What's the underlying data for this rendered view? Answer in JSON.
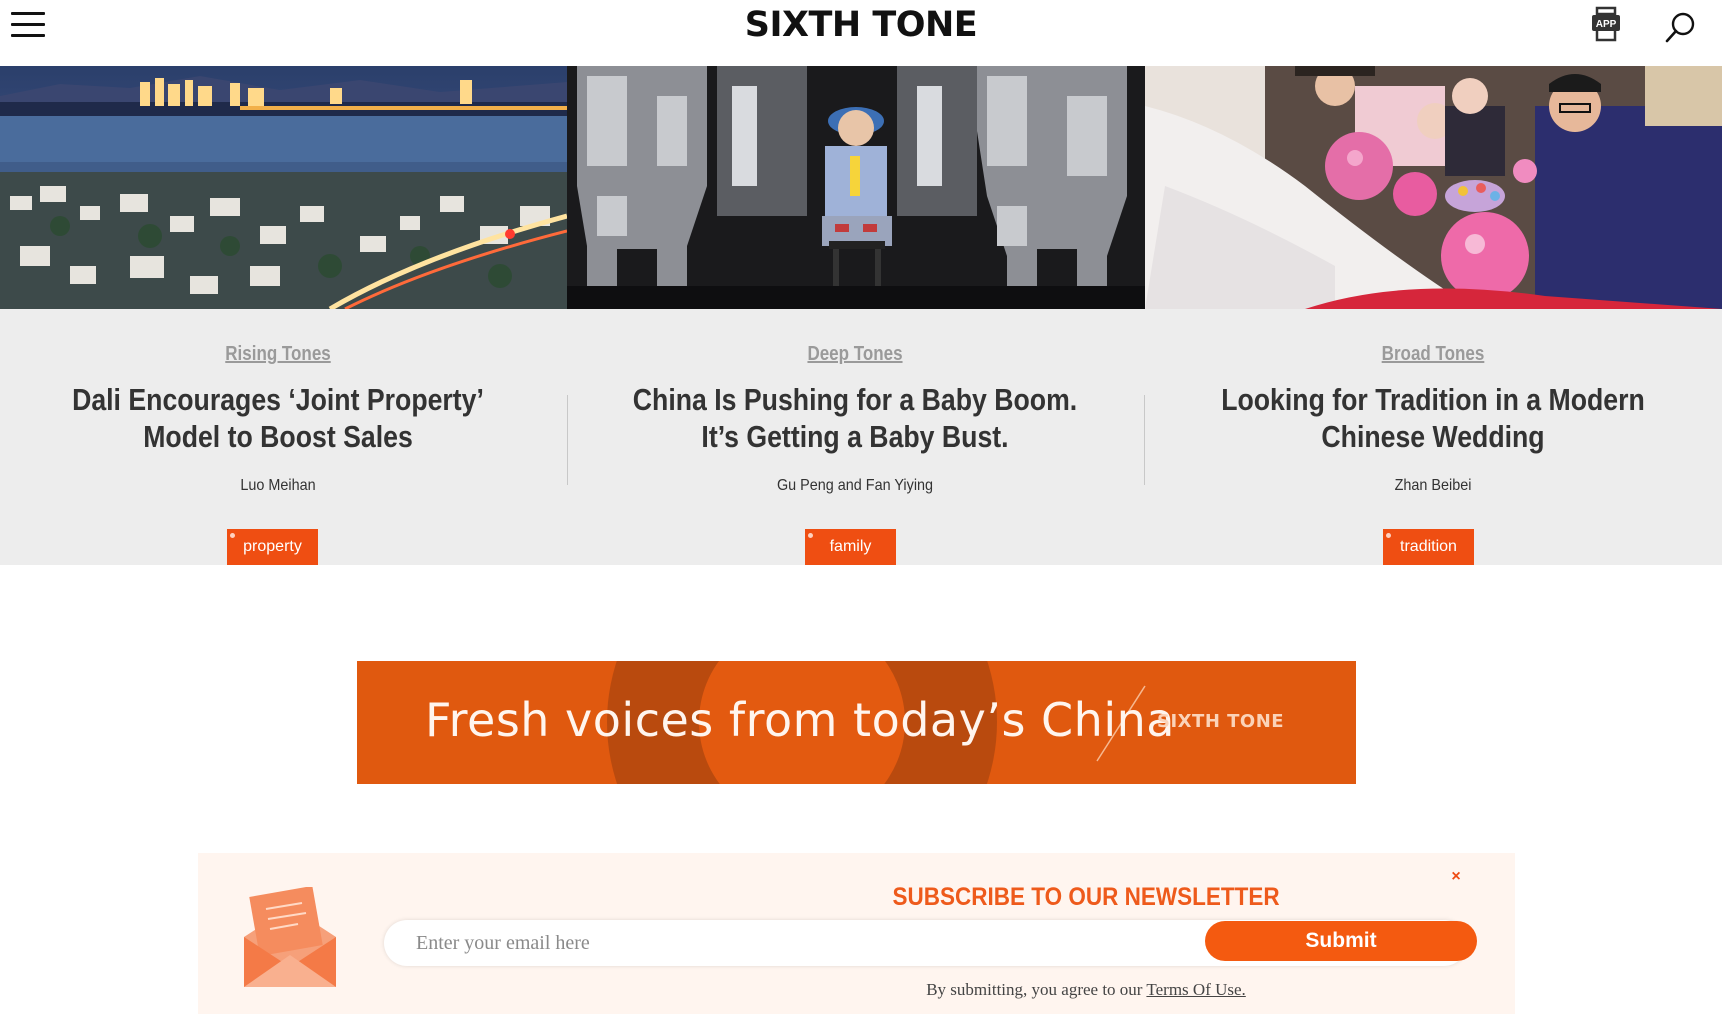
{
  "header": {
    "logo": "SIXTH TONE",
    "app_label": "APP"
  },
  "articles": [
    {
      "category": "Rising Tones",
      "title": "Dali Encourages ‘Joint Property’ Model to Boost Sales",
      "author": "Luo Meihan",
      "tag": "property"
    },
    {
      "category": "Deep Tones",
      "title": "China Is Pushing for a Baby Boom. It’s Getting a Baby Bust.",
      "author": "Gu Peng  and Fan Yiying",
      "tag": "family"
    },
    {
      "category": "Broad Tones",
      "title": "Looking for Tradition in a Modern Chinese Wedding",
      "author": "Zhan Beibei",
      "tag": "tradition"
    }
  ],
  "banner": {
    "text": "Fresh voices from today’s China",
    "logo": "SIXTH TONE"
  },
  "newsletter": {
    "title": "SUBSCRIBE TO OUR NEWSLETTER",
    "email_placeholder": "Enter your email here",
    "submit_label": "Submit",
    "terms_prefix": "By submitting, you agree to our",
    "terms_link": "Terms Of Use.",
    "close_symbol": "×"
  },
  "colors": {
    "accent": "#ef4e12",
    "band_bg": "#ededed",
    "newsletter_bg": "#fff5ef",
    "banner_bg": "#e0590f"
  }
}
